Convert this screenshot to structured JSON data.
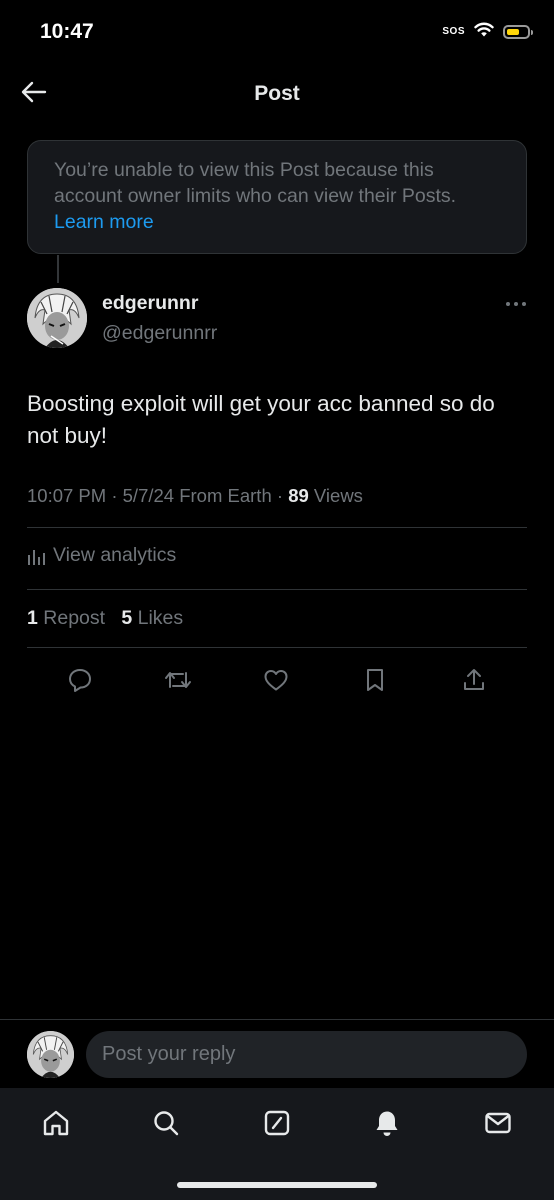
{
  "status_bar": {
    "time": "10:47",
    "sos_label": "SOS",
    "icons": [
      "wifi-icon",
      "battery-icon"
    ],
    "battery_color": "#ffd60a"
  },
  "header": {
    "title": "Post",
    "back_icon": "arrow-left-icon"
  },
  "notice": {
    "text": "You’re unable to view this Post because this account owner limits who can view their Posts.",
    "link_label": "Learn more",
    "link_color": "#1d9bf0"
  },
  "post": {
    "author_name": "edgerunnr",
    "author_handle": "@edgerunnrr",
    "text": "Boosting exploit will get your acc banned so do not buy!",
    "time": "10:07 PM",
    "date": "5/7/24",
    "source": "From Earth",
    "views_count": "89",
    "views_label": "Views",
    "analytics_label": "View analytics",
    "reposts_count": "1",
    "reposts_label": "Repost",
    "likes_count": "5",
    "likes_label": "Likes",
    "actions": [
      "reply-icon",
      "repost-icon",
      "like-icon",
      "bookmark-icon",
      "share-icon"
    ]
  },
  "reply": {
    "placeholder": "Post your reply"
  },
  "nav": {
    "items": [
      "home-icon",
      "search-icon",
      "grok-icon",
      "notifications-icon",
      "messages-icon"
    ]
  },
  "colors": {
    "background": "#000000",
    "text_primary": "#e7e9ea",
    "text_secondary": "#71767b",
    "border": "#2f3336"
  }
}
